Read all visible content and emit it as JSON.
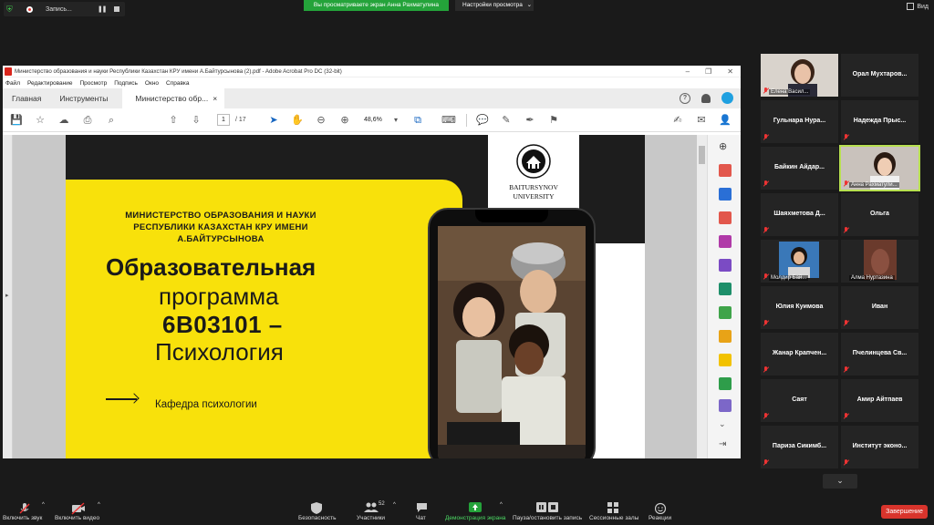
{
  "top": {
    "recording_label": "Запись...",
    "banner": "Вы просматриваете экран Анна Рахматулина",
    "view_settings": "Настройки просмотра",
    "view_settings_chevron": "⌄",
    "view_mode": "Вид"
  },
  "acrobat": {
    "title": "Министерство образования и науки Республики Казахстан КРУ имени А.Байтурсынова (2).pdf - Adobe Acrobat Pro DC (32-bit)",
    "menu": [
      "Файл",
      "Редактирование",
      "Просмотр",
      "Подпись",
      "Окно",
      "Справка"
    ],
    "tabs": {
      "home": "Главная",
      "tools": "Инструменты",
      "doc": "Министерство обр...",
      "doc_close": "×"
    },
    "page_current": "1",
    "page_total": "/ 17",
    "zoom": "48,6%"
  },
  "slide": {
    "ministry": "МИНИСТЕРСТВО ОБРАЗОВАНИЯ И НАУКИ РЕСПУБЛИКИ КАЗАХСТАН КРУ ИМЕНИ А.БАЙТУРСЫНОВА",
    "line1": "Образовательная",
    "line2": "программа",
    "line3": "6В03101 –",
    "line4": "Психология",
    "department": "Кафедра психологии",
    "logo_line1": "BAITURSYNOV",
    "logo_line2": "UNIVERSITY"
  },
  "participants": [
    {
      "name": "Елена Васил...",
      "video": true
    },
    {
      "name": "Орал  Мухтаров..."
    },
    {
      "name": "Гульнара  Нура..."
    },
    {
      "name": "Надежда  Прыс..."
    },
    {
      "name": "Байкин  Айдар..."
    },
    {
      "name": "Анна Рахматули...",
      "video": true,
      "active": true
    },
    {
      "name": "Шаяхметова  Д..."
    },
    {
      "name": "Ольга"
    },
    {
      "name": "Молдир Бай...",
      "video": true
    },
    {
      "name": "Алма Нуртазина",
      "video": true
    },
    {
      "name": "Юлия  Куимова"
    },
    {
      "name": "Иван"
    },
    {
      "name": "Жанар  Крапчен..."
    },
    {
      "name": "Пчелинцева  Св..."
    },
    {
      "name": "Саят"
    },
    {
      "name": "Амир  Айтпаев"
    },
    {
      "name": "Париза  Сикимб..."
    },
    {
      "name": "Институт  эконо..."
    }
  ],
  "bottom": {
    "unmute": "Включить звук",
    "start_video": "Включить видео",
    "security": "Безопасность",
    "participants": "Участники",
    "participants_count": "52",
    "chat": "Чат",
    "share": "Демонстрация экрана",
    "pause_record": "Пауза/остановить запись",
    "breakout": "Сессионные залы",
    "reactions": "Реакции",
    "end": "Завершение"
  }
}
